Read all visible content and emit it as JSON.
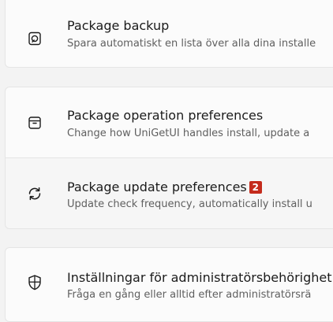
{
  "settings": {
    "backup": {
      "icon": "package-backup-icon",
      "title": "Package backup",
      "subtitle": "Spara automatiskt en lista över alla dina installe"
    },
    "operation": {
      "icon": "package-box-icon",
      "title": "Package operation preferences",
      "subtitle": "Change how UniGetUI handles install, update a"
    },
    "update": {
      "icon": "refresh-icon",
      "title": "Package update preferences",
      "badge": "2",
      "subtitle": "Update check frequency, automatically install u"
    },
    "admin": {
      "icon": "shield-icon",
      "title": "Inställningar för administratörsbehörighet",
      "subtitle": "Fråga en gång eller alltid efter administratörsrä"
    }
  },
  "colors": {
    "badge": "#c42b1c",
    "card": "#fbfbfb",
    "background": "#f3f3f3"
  }
}
